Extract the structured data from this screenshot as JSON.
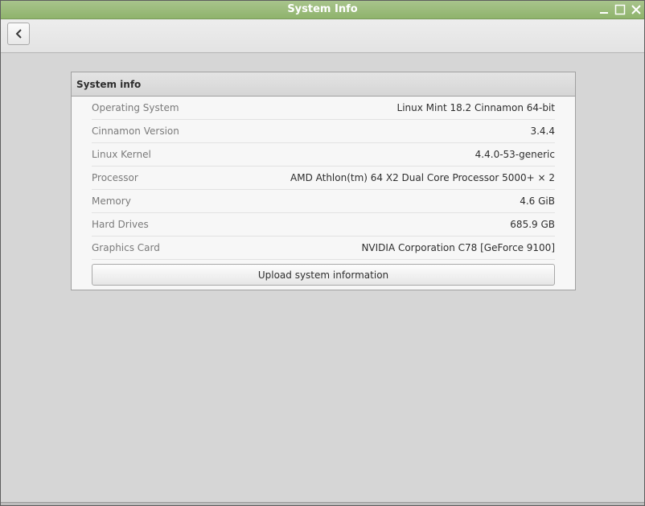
{
  "window": {
    "title": "System Info",
    "controls": {
      "minimize_icon": "minimize-icon",
      "maximize_icon": "maximize-icon",
      "close_icon": "close-icon"
    }
  },
  "toolbar": {
    "back_icon": "chevron-left-icon"
  },
  "panel": {
    "header": "System info",
    "rows": [
      {
        "label": "Operating System",
        "value": "Linux Mint 18.2 Cinnamon 64-bit"
      },
      {
        "label": "Cinnamon Version",
        "value": "3.4.4"
      },
      {
        "label": "Linux Kernel",
        "value": "4.4.0-53-generic"
      },
      {
        "label": "Processor",
        "value": "AMD Athlon(tm) 64 X2 Dual Core Processor 5000+ × 2"
      },
      {
        "label": "Memory",
        "value": "4.6 GiB"
      },
      {
        "label": "Hard Drives",
        "value": "685.9 GB"
      },
      {
        "label": "Graphics Card",
        "value": "NVIDIA Corporation C78 [GeForce 9100]"
      }
    ],
    "upload_button": "Upload system information"
  },
  "colors": {
    "titlebar": "#9cbc7c",
    "window_bg": "#d6d6d6",
    "panel_bg": "#f7f7f7"
  }
}
